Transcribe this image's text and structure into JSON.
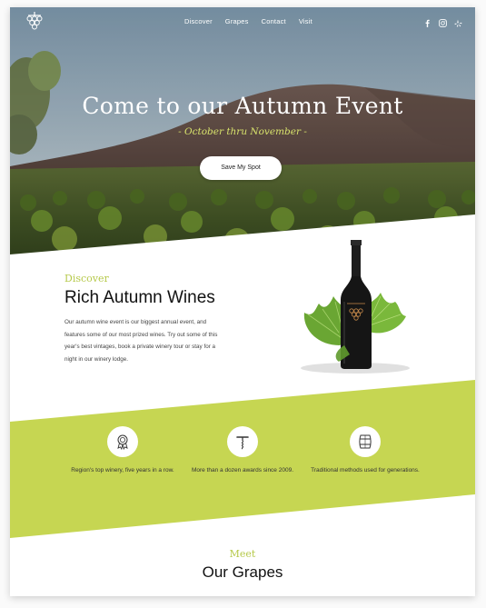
{
  "nav": {
    "items": [
      "Discover",
      "Grapes",
      "Contact",
      "Visit"
    ],
    "social_icons": [
      "facebook-icon",
      "instagram-icon",
      "yelp-icon"
    ]
  },
  "hero": {
    "title": "Come to our Autumn Event",
    "subtitle": "- October thru November -",
    "cta_label": "Save My Spot"
  },
  "discover": {
    "kicker": "Discover",
    "title": "Rich Autumn Wines",
    "body": "Our autumn wine event is our biggest annual event,  and features some of our most prized wines. Try out some of this year's best vintages, book a private winery tour or stay for a night in our winery lodge."
  },
  "features": [
    {
      "icon": "award-medal-icon",
      "text": "Region's top winery, five years in a row."
    },
    {
      "icon": "corkscrew-icon",
      "text": "More than a dozen awards since 2009."
    },
    {
      "icon": "barrel-icon",
      "text": "Traditional methods used for generations."
    }
  ],
  "meet": {
    "kicker": "Meet",
    "title": "Our Grapes"
  },
  "colors": {
    "accent_green": "#c6d652",
    "hero_sub": "#d8e36c",
    "kicker": "#b6c94b"
  }
}
